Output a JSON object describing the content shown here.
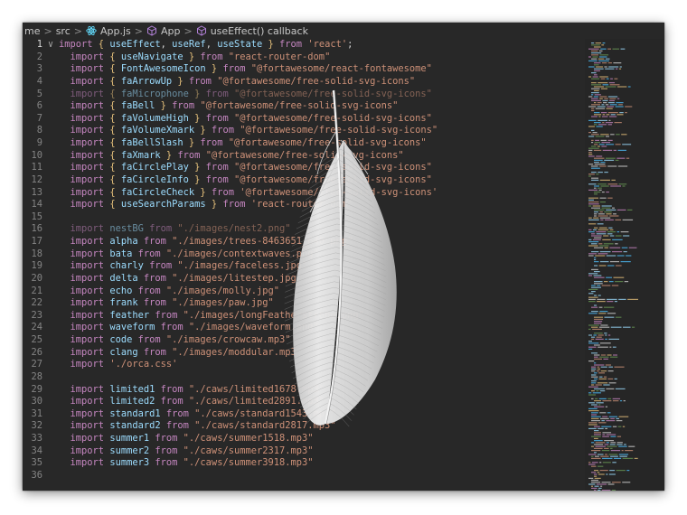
{
  "breadcrumb": {
    "items": [
      "me",
      "src",
      "App.js",
      "App",
      "useEffect() callback"
    ],
    "separator": ">"
  },
  "editor": {
    "lines": [
      {
        "n": "1",
        "tokens": [
          [
            "kw",
            "import "
          ],
          [
            "br",
            "{ "
          ],
          [
            "id",
            "useEffect"
          ],
          [
            "pl",
            ", "
          ],
          [
            "id",
            "useRef"
          ],
          [
            "pl",
            ", "
          ],
          [
            "id",
            "useState"
          ],
          [
            "br",
            " }"
          ],
          [
            "kw",
            " from "
          ],
          [
            "st",
            "'react'"
          ],
          [
            "pl",
            ";"
          ]
        ]
      },
      {
        "n": "2",
        "tokens": [
          [
            "kw",
            "  import "
          ],
          [
            "br",
            "{ "
          ],
          [
            "id",
            "useNavigate"
          ],
          [
            "br",
            " }"
          ],
          [
            "kw",
            " from "
          ],
          [
            "st",
            "\"react-router-dom\""
          ]
        ]
      },
      {
        "n": "3",
        "tokens": [
          [
            "kw",
            "  import "
          ],
          [
            "br",
            "{ "
          ],
          [
            "id",
            "FontAwesomeIcon"
          ],
          [
            "br",
            " }"
          ],
          [
            "kw",
            " from "
          ],
          [
            "st",
            "\"@fortawesome/react-fontawesome\""
          ]
        ]
      },
      {
        "n": "4",
        "tokens": [
          [
            "kw",
            "  import "
          ],
          [
            "br",
            "{ "
          ],
          [
            "id",
            "faArrowUp"
          ],
          [
            "br",
            " }"
          ],
          [
            "kw",
            " from "
          ],
          [
            "st",
            "\"@fortawesome/free-solid-svg-icons\""
          ]
        ]
      },
      {
        "n": "5",
        "dim": true,
        "tokens": [
          [
            "kw",
            "  import "
          ],
          [
            "br",
            "{ "
          ],
          [
            "id",
            "faMicrophone"
          ],
          [
            "br",
            " }"
          ],
          [
            "kw",
            " from "
          ],
          [
            "st",
            "\"@fortawesome/free-solid-svg-icons\""
          ]
        ]
      },
      {
        "n": "6",
        "tokens": [
          [
            "kw",
            "  import "
          ],
          [
            "br",
            "{ "
          ],
          [
            "id",
            "faBell"
          ],
          [
            "br",
            " }"
          ],
          [
            "kw",
            " from "
          ],
          [
            "st",
            "\"@fortawesome/free-solid-svg-icons\""
          ]
        ]
      },
      {
        "n": "7",
        "tokens": [
          [
            "kw",
            "  import "
          ],
          [
            "br",
            "{ "
          ],
          [
            "id",
            "faVolumeHigh"
          ],
          [
            "br",
            " }"
          ],
          [
            "kw",
            " from "
          ],
          [
            "st",
            "\"@fortawesome/free-solid-svg-icons\""
          ]
        ]
      },
      {
        "n": "8",
        "tokens": [
          [
            "kw",
            "  import "
          ],
          [
            "br",
            "{ "
          ],
          [
            "id",
            "faVolumeXmark"
          ],
          [
            "br",
            " }"
          ],
          [
            "kw",
            " from "
          ],
          [
            "st",
            "\"@fortawesome/free-solid-svg-icons\""
          ]
        ]
      },
      {
        "n": "9",
        "tokens": [
          [
            "kw",
            "  import "
          ],
          [
            "br",
            "{ "
          ],
          [
            "id",
            "faBellSlash"
          ],
          [
            "br",
            " }"
          ],
          [
            "kw",
            " from "
          ],
          [
            "st",
            "\"@fortawesome/free-solid-svg-icons\""
          ]
        ]
      },
      {
        "n": "10",
        "tokens": [
          [
            "kw",
            "  import "
          ],
          [
            "br",
            "{ "
          ],
          [
            "id",
            "faXmark"
          ],
          [
            "br",
            " }"
          ],
          [
            "kw",
            " from "
          ],
          [
            "st",
            "\"@fortawesome/free-solid-svg-icons\""
          ]
        ]
      },
      {
        "n": "11",
        "tokens": [
          [
            "kw",
            "  import "
          ],
          [
            "br",
            "{ "
          ],
          [
            "id",
            "faCirclePlay"
          ],
          [
            "br",
            " }"
          ],
          [
            "kw",
            " from "
          ],
          [
            "st",
            "\"@fortawesome/free-solid-svg-icons\""
          ]
        ]
      },
      {
        "n": "12",
        "tokens": [
          [
            "kw",
            "  import "
          ],
          [
            "br",
            "{ "
          ],
          [
            "id",
            "faCircleInfo"
          ],
          [
            "br",
            " }"
          ],
          [
            "kw",
            " from "
          ],
          [
            "st",
            "\"@fortawesome/free-solid-svg-icons\""
          ]
        ]
      },
      {
        "n": "13",
        "tokens": [
          [
            "kw",
            "  import "
          ],
          [
            "br",
            "{ "
          ],
          [
            "id",
            "faCircleCheck"
          ],
          [
            "br",
            " }"
          ],
          [
            "kw",
            " from "
          ],
          [
            "st",
            "'@fortawesome/free-solid-svg-icons'"
          ]
        ]
      },
      {
        "n": "14",
        "tokens": [
          [
            "kw",
            "  import "
          ],
          [
            "br",
            "{ "
          ],
          [
            "id",
            "useSearchParams"
          ],
          [
            "br",
            " }"
          ],
          [
            "kw",
            " from "
          ],
          [
            "st",
            "'react-router-dom'"
          ]
        ]
      },
      {
        "n": "15",
        "tokens": []
      },
      {
        "n": "16",
        "dim": true,
        "tokens": [
          [
            "kw",
            "  import "
          ],
          [
            "id",
            "nestBG"
          ],
          [
            "kw",
            " from "
          ],
          [
            "st",
            "\"./images/nest2.png\""
          ]
        ]
      },
      {
        "n": "17",
        "tokens": [
          [
            "kw",
            "  import "
          ],
          [
            "id",
            "alpha"
          ],
          [
            "kw",
            " from "
          ],
          [
            "st",
            "\"./images/trees-8463651_640.png\""
          ]
        ]
      },
      {
        "n": "18",
        "tokens": [
          [
            "kw",
            "  import "
          ],
          [
            "id",
            "bata"
          ],
          [
            "kw",
            " from "
          ],
          [
            "st",
            "\"./images/contextwaves.png\""
          ]
        ]
      },
      {
        "n": "19",
        "tokens": [
          [
            "kw",
            "  import "
          ],
          [
            "id",
            "charly"
          ],
          [
            "kw",
            " from "
          ],
          [
            "st",
            "\"./images/faceless.jpg\""
          ]
        ]
      },
      {
        "n": "20",
        "tokens": [
          [
            "kw",
            "  import "
          ],
          [
            "id",
            "delta"
          ],
          [
            "kw",
            " from "
          ],
          [
            "st",
            "\"./images/litestep.jpg\""
          ]
        ]
      },
      {
        "n": "21",
        "tokens": [
          [
            "kw",
            "  import "
          ],
          [
            "id",
            "echo"
          ],
          [
            "kw",
            " from "
          ],
          [
            "st",
            "\"./images/molly.jpg\""
          ]
        ]
      },
      {
        "n": "22",
        "tokens": [
          [
            "kw",
            "  import "
          ],
          [
            "id",
            "frank"
          ],
          [
            "kw",
            " from "
          ],
          [
            "st",
            "\"./images/paw.jpg\""
          ]
        ]
      },
      {
        "n": "23",
        "tokens": [
          [
            "kw",
            "  import "
          ],
          [
            "id",
            "feather"
          ],
          [
            "kw",
            " from "
          ],
          [
            "st",
            "\"./images/longFeatherstrobe.png\""
          ]
        ]
      },
      {
        "n": "24",
        "tokens": [
          [
            "kw",
            "  import "
          ],
          [
            "id",
            "waveform"
          ],
          [
            "kw",
            " from "
          ],
          [
            "st",
            "\"./images/waveform.png\""
          ]
        ]
      },
      {
        "n": "25",
        "tokens": [
          [
            "kw",
            "  import "
          ],
          [
            "id",
            "code"
          ],
          [
            "kw",
            " from "
          ],
          [
            "st",
            "\"./images/crowcaw.mp3\""
          ]
        ]
      },
      {
        "n": "26",
        "tokens": [
          [
            "kw",
            "  import "
          ],
          [
            "id",
            "clang"
          ],
          [
            "kw",
            " from "
          ],
          [
            "st",
            "\"./images/moddular.mp3\""
          ]
        ]
      },
      {
        "n": "27",
        "tokens": [
          [
            "kw",
            "  import "
          ],
          [
            "st",
            "'./orca.css'"
          ]
        ]
      },
      {
        "n": "28",
        "tokens": []
      },
      {
        "n": "29",
        "tokens": [
          [
            "kw",
            "  import "
          ],
          [
            "id",
            "limited1"
          ],
          [
            "kw",
            " from "
          ],
          [
            "st",
            "\"./caws/limited1678.mp3\""
          ]
        ]
      },
      {
        "n": "30",
        "tokens": [
          [
            "kw",
            "  import "
          ],
          [
            "id",
            "limited2"
          ],
          [
            "kw",
            " from "
          ],
          [
            "st",
            "\"./caws/limited2891.mp3\""
          ]
        ]
      },
      {
        "n": "31",
        "tokens": [
          [
            "kw",
            "  import "
          ],
          [
            "id",
            "standard1"
          ],
          [
            "kw",
            " from "
          ],
          [
            "st",
            "\"./caws/standard1543.mp3\""
          ]
        ]
      },
      {
        "n": "32",
        "tokens": [
          [
            "kw",
            "  import "
          ],
          [
            "id",
            "standard2"
          ],
          [
            "kw",
            " from "
          ],
          [
            "st",
            "\"./caws/standard2817.mp3\""
          ]
        ]
      },
      {
        "n": "33",
        "tokens": [
          [
            "kw",
            "  import "
          ],
          [
            "id",
            "summer1"
          ],
          [
            "kw",
            " from "
          ],
          [
            "st",
            "\"./caws/summer1518.mp3\""
          ]
        ]
      },
      {
        "n": "34",
        "tokens": [
          [
            "kw",
            "  import "
          ],
          [
            "id",
            "summer2"
          ],
          [
            "kw",
            " from "
          ],
          [
            "st",
            "\"./caws/summer2317.mp3\""
          ]
        ]
      },
      {
        "n": "35",
        "tokens": [
          [
            "kw",
            "  import "
          ],
          [
            "id",
            "summer3"
          ],
          [
            "kw",
            " from "
          ],
          [
            "st",
            "\"./caws/summer3918.mp3\""
          ]
        ]
      },
      {
        "n": "36",
        "tokens": []
      }
    ]
  },
  "overlay": {
    "icon": "feather-icon"
  },
  "colors": {
    "editor_bg": "#282828",
    "keyword": "#c586c0",
    "brace": "#e5c07b",
    "identifier": "#9cdcfe",
    "string": "#ce9178"
  }
}
